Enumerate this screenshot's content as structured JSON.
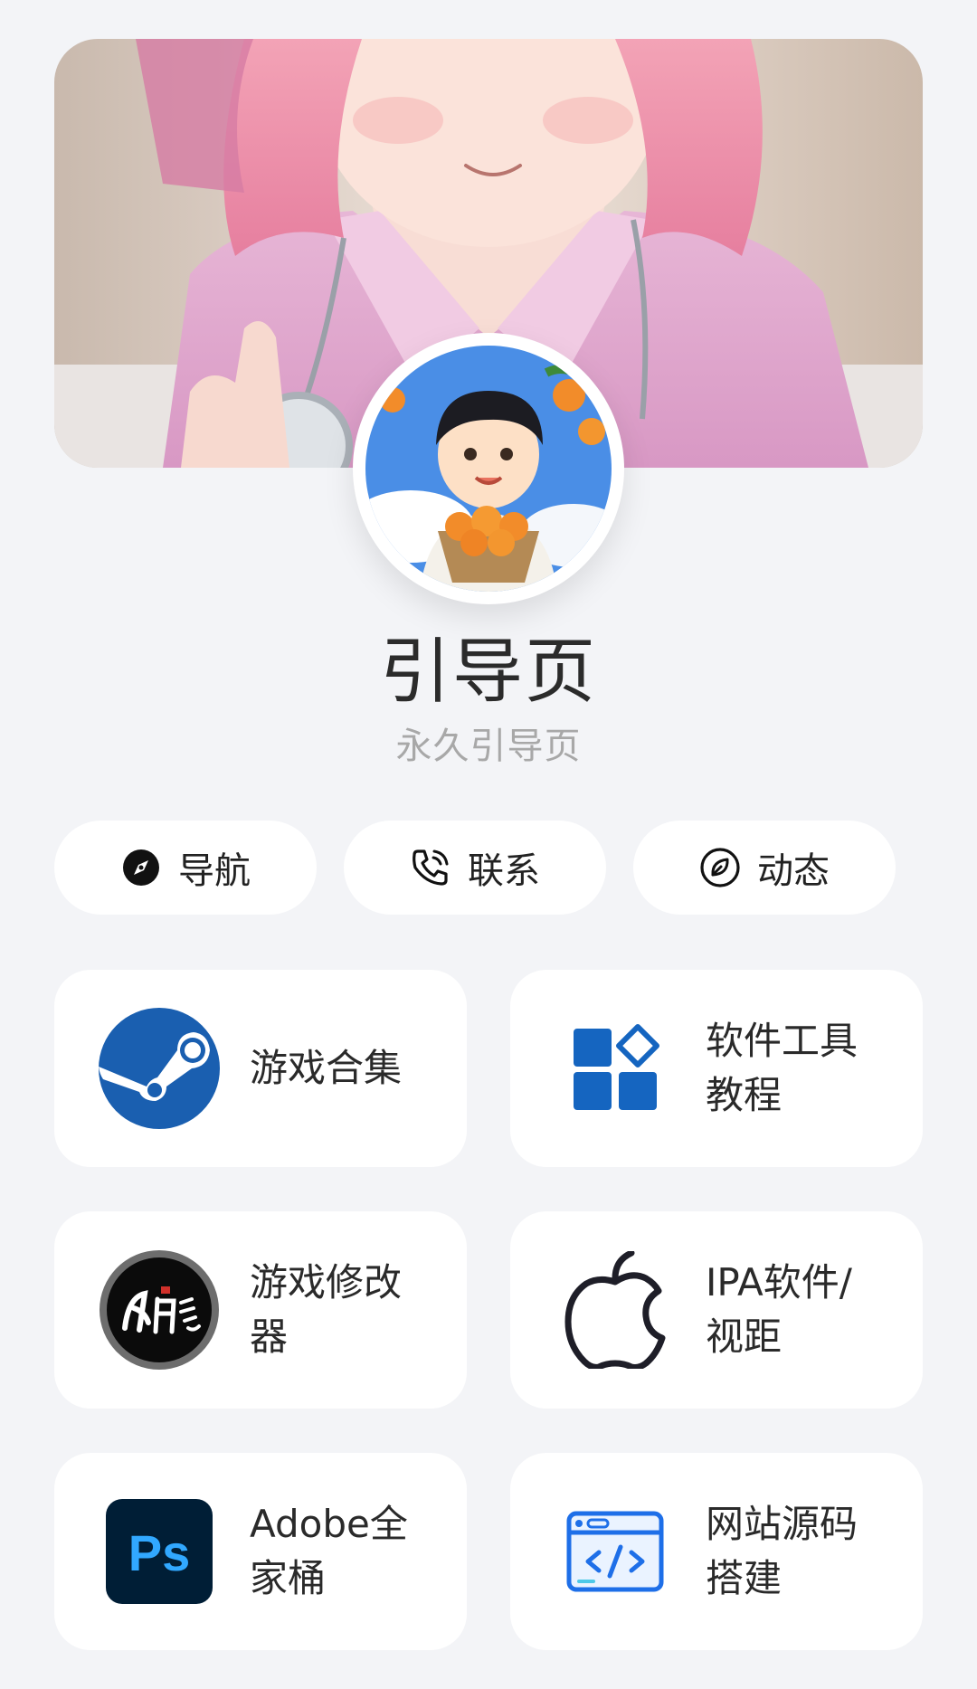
{
  "header": {
    "banner_image": "anime-illustration",
    "avatar_image": "boy-with-oranges-avatar",
    "title": "引导页",
    "subtitle": "永久引导页"
  },
  "quick_links": [
    {
      "label": "导航",
      "icon": "compass-icon"
    },
    {
      "label": "联系",
      "icon": "phone-icon"
    },
    {
      "label": "动态",
      "icon": "leaf-circle-icon"
    }
  ],
  "cards": [
    {
      "label": "游戏合集",
      "icon": "steam-icon"
    },
    {
      "label": "软件工具教程",
      "icon": "apps-grid-icon"
    },
    {
      "label": "游戏修改器",
      "icon": "fengyueyingying-logo"
    },
    {
      "label": "IPA软件/视距",
      "icon": "apple-icon"
    },
    {
      "label": "Adobe全家桶",
      "icon": "photoshop-icon",
      "logo_text": "Ps"
    },
    {
      "label": "网站源码搭建",
      "icon": "code-window-icon"
    }
  ],
  "colors": {
    "background": "#f3f4f7",
    "steam_blue": "#1a5fb0",
    "apps_blue": "#1565c0",
    "ps_dark": "#001e36",
    "ps_blue": "#31a8ff",
    "code_blue": "#1e6fe8"
  }
}
